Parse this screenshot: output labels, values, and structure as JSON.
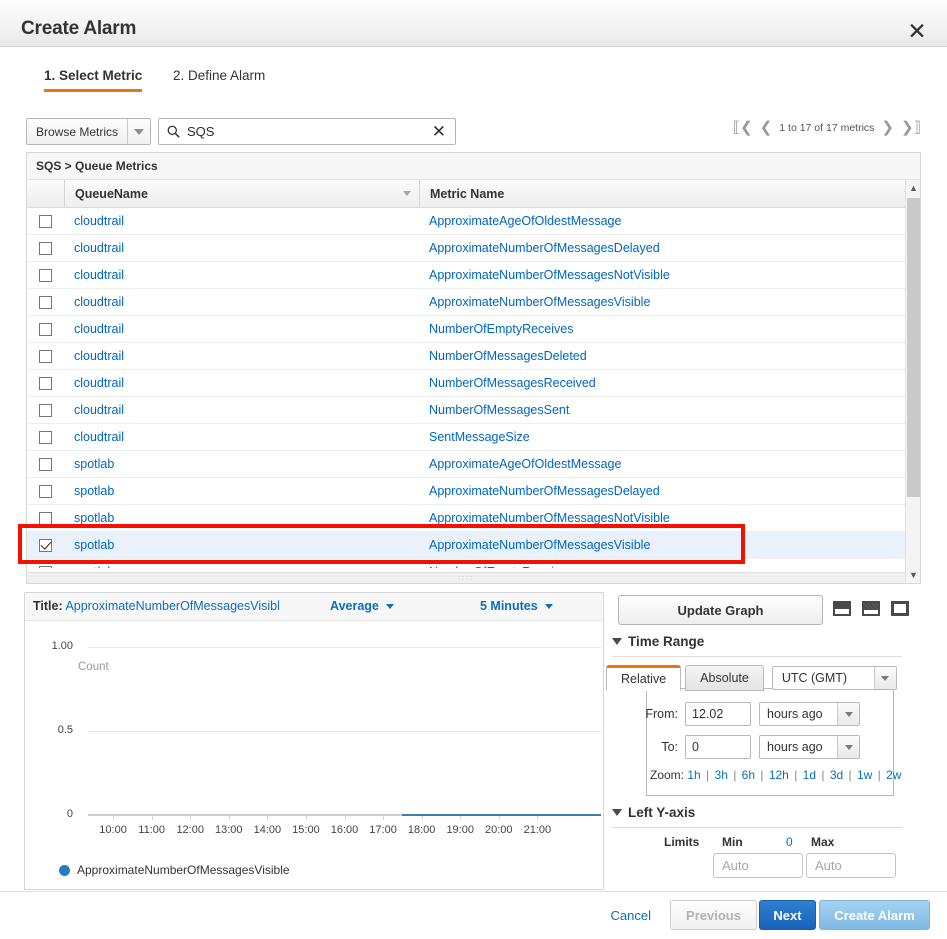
{
  "dialog": {
    "title": "Create Alarm",
    "close_icon": "close-icon"
  },
  "steps": [
    {
      "label": "1. Select Metric",
      "active": true
    },
    {
      "label": "2. Define Alarm",
      "active": false
    }
  ],
  "toolbar": {
    "browse_metrics_label": "Browse Metrics",
    "search_value": "SQS",
    "search_clear_label": "✕",
    "pager_text": "1 to 17 of 17 metrics",
    "first_icon": "first-page-icon",
    "prev_icon": "prev-page-icon",
    "next_icon": "next-page-icon",
    "last_icon": "last-page-icon"
  },
  "table": {
    "breadcrumb": "SQS > Queue Metrics",
    "columns": [
      "QueueName",
      "Metric Name"
    ],
    "rows": [
      {
        "queue": "cloudtrail",
        "metric": "ApproximateAgeOfOldestMessage",
        "checked": false
      },
      {
        "queue": "cloudtrail",
        "metric": "ApproximateNumberOfMessagesDelayed",
        "checked": false
      },
      {
        "queue": "cloudtrail",
        "metric": "ApproximateNumberOfMessagesNotVisible",
        "checked": false
      },
      {
        "queue": "cloudtrail",
        "metric": "ApproximateNumberOfMessagesVisible",
        "checked": false
      },
      {
        "queue": "cloudtrail",
        "metric": "NumberOfEmptyReceives",
        "checked": false
      },
      {
        "queue": "cloudtrail",
        "metric": "NumberOfMessagesDeleted",
        "checked": false
      },
      {
        "queue": "cloudtrail",
        "metric": "NumberOfMessagesReceived",
        "checked": false
      },
      {
        "queue": "cloudtrail",
        "metric": "NumberOfMessagesSent",
        "checked": false
      },
      {
        "queue": "cloudtrail",
        "metric": "SentMessageSize",
        "checked": false
      },
      {
        "queue": "spotlab",
        "metric": "ApproximateAgeOfOldestMessage",
        "checked": false
      },
      {
        "queue": "spotlab",
        "metric": "ApproximateNumberOfMessagesDelayed",
        "checked": false
      },
      {
        "queue": "spotlab",
        "metric": "ApproximateNumberOfMessagesNotVisible",
        "checked": false
      },
      {
        "queue": "spotlab",
        "metric": "ApproximateNumberOfMessagesVisible",
        "checked": true
      },
      {
        "queue": "spotlab",
        "metric": "NumberOfEmptyReceives",
        "checked": false
      }
    ],
    "annotation_color": "#f51000"
  },
  "graph": {
    "title_label": "Title:",
    "title_value": "ApproximateNumberOfMessagesVisibl",
    "statistic": "Average",
    "period": "5 Minutes",
    "legend": "ApproximateNumberOfMessagesVisible"
  },
  "chart_data": {
    "type": "line",
    "title": "ApproximateNumberOfMessagesVisible",
    "xlabel": "",
    "ylabel": "Count",
    "ylim": [
      0,
      1.0
    ],
    "yticks": [
      "1.00",
      "0.5",
      "0"
    ],
    "ytick_values": [
      1.0,
      0.5,
      0
    ],
    "categories": [
      "10:00",
      "11:00",
      "12:00",
      "13:00",
      "14:00",
      "15:00",
      "16:00",
      "17:00",
      "18:00",
      "19:00",
      "20:00",
      "21:00"
    ],
    "series": [
      {
        "name": "ApproximateNumberOfMessagesVisible",
        "color": "#3f7fb0",
        "x": [
          "18:30",
          "19:00",
          "20:00",
          "21:00",
          "21:30"
        ],
        "values": [
          0,
          0,
          0,
          0,
          0
        ]
      }
    ],
    "grid": true,
    "legend_position": "bottom-left",
    "unit_label": "Count"
  },
  "controls": {
    "update_graph": "Update Graph",
    "layout_icons": [
      "graph-size-small-icon",
      "graph-size-medium-icon",
      "graph-size-large-icon"
    ],
    "time_range": {
      "section_label": "Time Range",
      "tabs": [
        {
          "label": "Relative",
          "active": true
        },
        {
          "label": "Absolute",
          "active": false
        }
      ],
      "timezone": "UTC (GMT)",
      "from_label": "From:",
      "from_value": "12.02",
      "from_unit": "hours ago",
      "to_label": "To:",
      "to_value": "0",
      "to_unit": "hours ago",
      "zoom_label": "Zoom:",
      "zoom_options": [
        "1h",
        "3h",
        "6h",
        "12h",
        "1d",
        "3d",
        "1w",
        "2w"
      ]
    },
    "left_y_axis": {
      "section_label": "Left Y-axis",
      "limits_label": "Limits",
      "min_label": "Min",
      "min_zero": "0",
      "max_label": "Max",
      "min_placeholder": "Auto",
      "max_placeholder": "Auto",
      "min_value": "",
      "max_value": ""
    }
  },
  "footer": {
    "cancel": "Cancel",
    "previous": "Previous",
    "next": "Next",
    "create_alarm": "Create Alarm"
  }
}
